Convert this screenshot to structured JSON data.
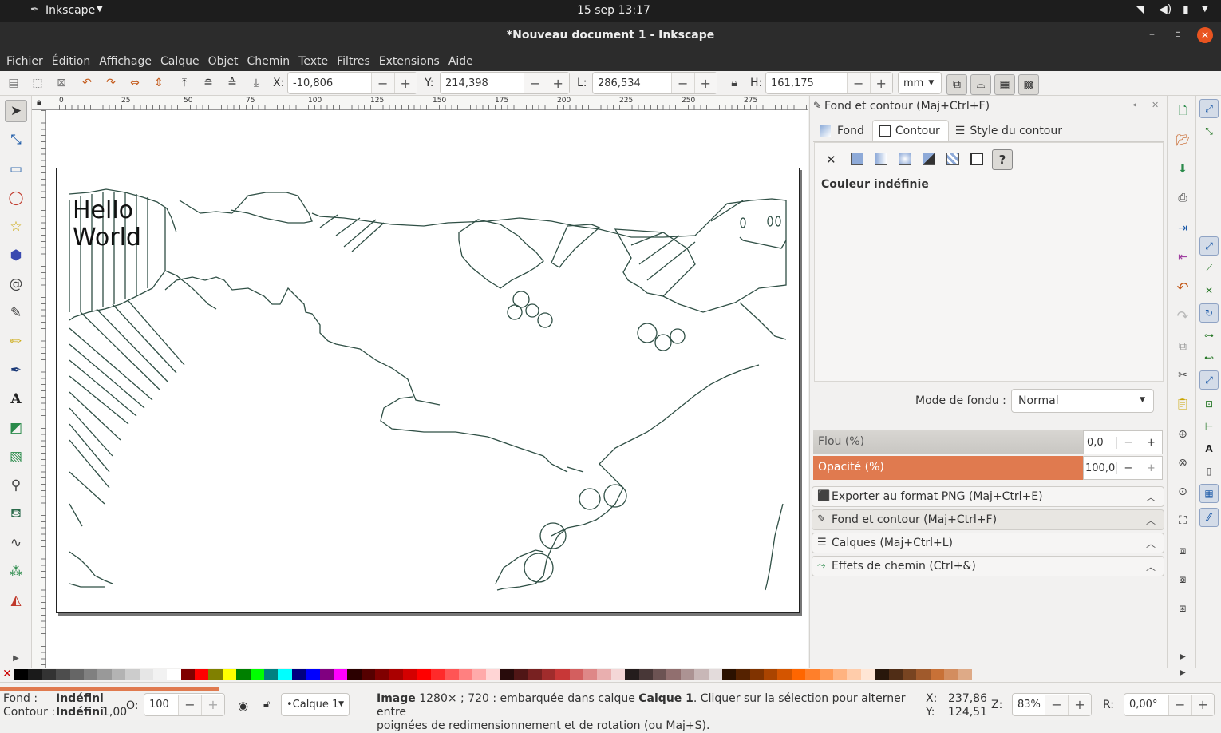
{
  "topbar": {
    "app_name": "Inkscape",
    "clock": "15 sep  13:17"
  },
  "window": {
    "title": "*Nouveau document 1 - Inkscape"
  },
  "menu": [
    "Fichier",
    "Édition",
    "Affichage",
    "Calque",
    "Objet",
    "Chemin",
    "Texte",
    "Filtres",
    "Extensions",
    "Aide"
  ],
  "toolbar": {
    "x_label": "X:",
    "x_value": "-10,806",
    "y_label": "Y:",
    "y_value": "214,398",
    "w_label": "L:",
    "w_value": "286,534",
    "h_label": "H:",
    "h_value": "161,175",
    "unit": "mm"
  },
  "ruler_marks": [
    "0",
    "25",
    "50",
    "75",
    "100",
    "125",
    "150",
    "175",
    "200",
    "225",
    "250",
    "275"
  ],
  "canvas": {
    "text_line1": "Hello",
    "text_line2": "World"
  },
  "panel": {
    "title": "Fond et contour (Maj+Ctrl+F)",
    "tabs": [
      "Fond",
      "Contour",
      "Style du contour"
    ],
    "paint_status": "Couleur indéfinie",
    "blend_label": "Mode de fondu :",
    "blend_value": "Normal",
    "blur_label": "Flou (%)",
    "blur_value": "0,0",
    "opacity_label": "Opacité (%)",
    "opacity_value": "100,0",
    "opacity_color": "#e07a4f",
    "docks": [
      "Exporter au format PNG (Maj+Ctrl+E)",
      "Fond et contour (Maj+Ctrl+F)",
      "Calques (Maj+Ctrl+L)",
      "Effets de chemin (Ctrl+&)"
    ]
  },
  "status": {
    "fill_label": "Fond :",
    "fill_value": "Indéfini",
    "stroke_label": "Contour :",
    "stroke_value": "Indéfini",
    "stroke_width": "1,00",
    "opacity_label": "O:",
    "opacity_value": "100",
    "layer": "•Calque 1",
    "message_bold1": "Image",
    "message_part1": " 1280× ; 720 : embarquée dans calque ",
    "message_bold2": "Calque 1",
    "message_part2": ". Cliquer sur la sélection pour alterner entre",
    "message_line2": "poignées de redimensionnement et de rotation (ou Maj+S).",
    "x_label": "X:",
    "x_value": "237,86",
    "y_label": "Y:",
    "y_value": "124,51",
    "zoom_label": "Z:",
    "zoom_value": "83%",
    "rotate_label": "R:",
    "rotate_value": "0,00°"
  },
  "palette": [
    "#000000",
    "#1a1a1a",
    "#333333",
    "#4d4d4d",
    "#666666",
    "#808080",
    "#999999",
    "#b3b3b3",
    "#cccccc",
    "#e6e6e6",
    "#f2f2f2",
    "#ffffff",
    "#800000",
    "#ff0000",
    "#808000",
    "#ffff00",
    "#008000",
    "#00ff00",
    "#008080",
    "#00ffff",
    "#000080",
    "#0000ff",
    "#800080",
    "#ff00ff",
    "#2b0000",
    "#550000",
    "#800000",
    "#aa0000",
    "#d40000",
    "#ff0000",
    "#ff2a2a",
    "#ff5555",
    "#ff8080",
    "#ffaaaa",
    "#ffd5d5",
    "#280b0b",
    "#501616",
    "#782121",
    "#a02c2c",
    "#c83737",
    "#d35f5f",
    "#de8787",
    "#e9afaf",
    "#f4d7d7",
    "#241c1c",
    "#483737",
    "#6c5353",
    "#916f6f",
    "#ac9393",
    "#c8b7b7",
    "#e3dbdb",
    "#2b1100",
    "#552200",
    "#803300",
    "#aa4400",
    "#d45500",
    "#ff6600",
    "#ff7f2a",
    "#ff9955",
    "#ffb380",
    "#ffccaa",
    "#ffe6d5",
    "#28170b",
    "#502d16",
    "#784421",
    "#a05a2c",
    "#c87137",
    "#d38d5f",
    "#deaa87"
  ]
}
